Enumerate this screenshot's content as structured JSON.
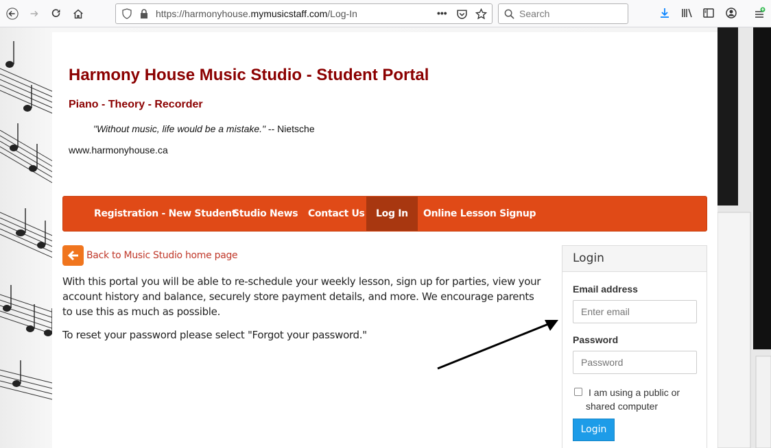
{
  "browser": {
    "url_prefix": "https://harmonyhouse.",
    "url_host": "mymusicstaff.com",
    "url_path": "/Log-In",
    "url_more": "•••",
    "search_placeholder": "Search"
  },
  "header": {
    "title": "Harmony House Music Studio - Student Portal",
    "subtitle": "Piano - Theory - Recorder",
    "quote": "\"Without music, life would be a mistake.\"",
    "quote_author": " -- Nietsche",
    "website": "www.harmonyhouse.ca"
  },
  "nav": {
    "items": [
      {
        "label": "Registration - New Student"
      },
      {
        "label": "Studio News"
      },
      {
        "label": "Contact Us"
      },
      {
        "label": "Log In"
      },
      {
        "label": "Online Lesson Signup"
      }
    ]
  },
  "main": {
    "back_link": "Back to Music Studio home page",
    "intro": "With this portal you will be able to re-schedule your weekly lesson, sign up for parties, view your account history and balance, securely store payment details, and more. We encourage parents to use this as much as possible.",
    "reset": "To reset your password please select \"Forgot your password.\""
  },
  "login": {
    "heading": "Login",
    "email_label": "Email address",
    "email_placeholder": "Enter email",
    "password_label": "Password",
    "password_placeholder": "Password",
    "public_computer_label": "I am using a public or shared computer",
    "button": "Login"
  },
  "colors": {
    "title": "#8b0000",
    "nav_bg": "#e04a17",
    "nav_active": "#a83710",
    "back_link": "#c0392b",
    "login_button": "#1d9ce8"
  }
}
